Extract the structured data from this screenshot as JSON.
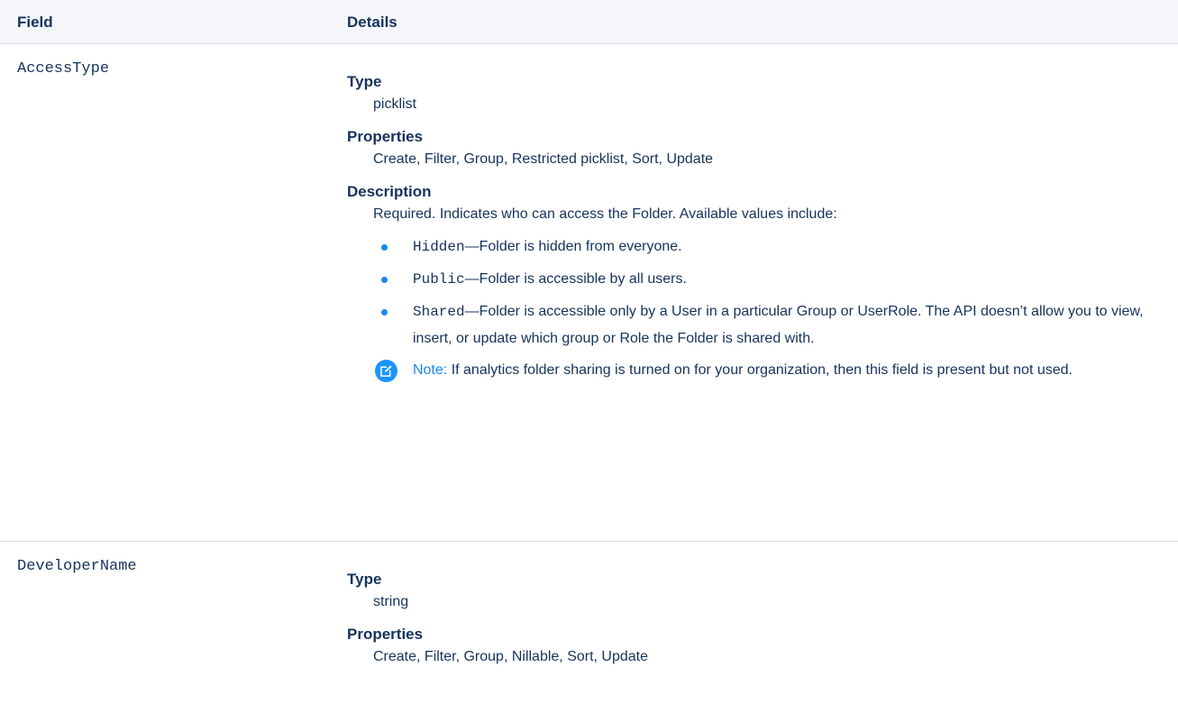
{
  "header": {
    "field": "Field",
    "details": "Details"
  },
  "rows": [
    {
      "field": "AccessType",
      "type_label": "Type",
      "type_value": "picklist",
      "properties_label": "Properties",
      "properties_value": "Create, Filter, Group, Restricted picklist, Sort, Update",
      "description_label": "Description",
      "description_intro": "Required. Indicates who can access the Folder. Available values include:",
      "bullets": [
        {
          "code": "Hidden",
          "text": "—Folder is hidden from everyone."
        },
        {
          "code": "Public",
          "text": "—Folder is accessible by all users."
        },
        {
          "code": "Shared",
          "text": "—Folder is accessible only by a User in a particular Group or UserRole. The API doesn’t allow you to view, insert, or update which group or Role the Folder is shared with."
        }
      ],
      "note_label": "Note:",
      "note_text": " If analytics folder sharing is turned on for your organization, then this field is present but not used.",
      "note_icon": "edit-note-icon"
    },
    {
      "field": "DeveloperName",
      "type_label": "Type",
      "type_value": "string",
      "properties_label": "Properties",
      "properties_value": "Create, Filter, Group, Nillable, Sort, Update"
    }
  ],
  "colors": {
    "text": "#16325c",
    "accent": "#1589ee",
    "header_bg": "#f4f6f9",
    "divider": "#d8dde6"
  }
}
